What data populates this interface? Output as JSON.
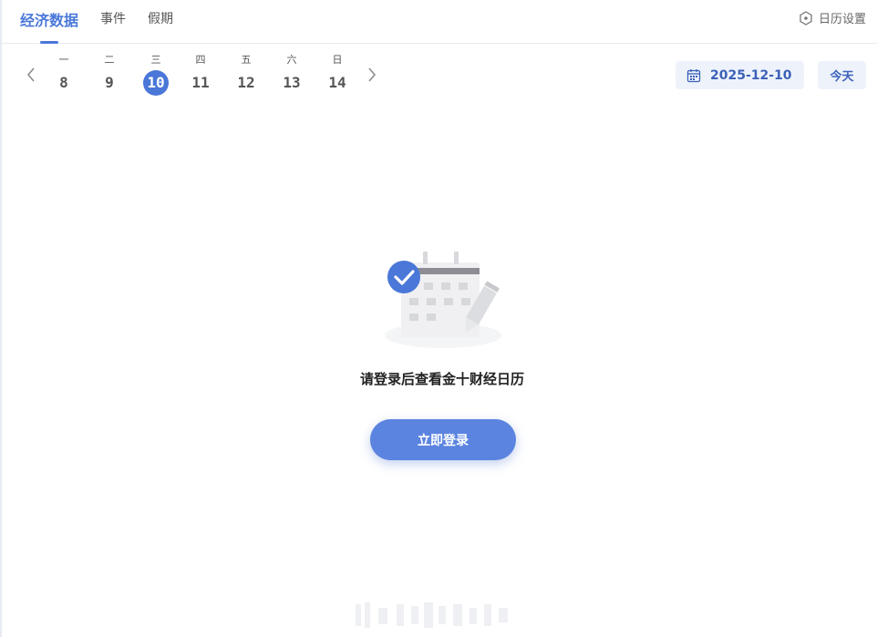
{
  "header": {
    "tabs": [
      {
        "label": "经济数据",
        "active": true
      },
      {
        "label": "事件",
        "active": false
      },
      {
        "label": "假期",
        "active": false
      }
    ],
    "settings_label": "日历设置",
    "settings_icon": "hexagon-settings-icon"
  },
  "week": {
    "prev_icon": "chevron-left-icon",
    "next_icon": "chevron-right-icon",
    "days": [
      {
        "weekday": "一",
        "num": "8"
      },
      {
        "weekday": "二",
        "num": "9"
      },
      {
        "weekday": "三",
        "num": "10",
        "selected": true
      },
      {
        "weekday": "四",
        "num": "11"
      },
      {
        "weekday": "五",
        "num": "12"
      },
      {
        "weekday": "六",
        "num": "13"
      },
      {
        "weekday": "日",
        "num": "14"
      }
    ]
  },
  "date_picker": {
    "value": "2025-12-10",
    "icon": "calendar-icon"
  },
  "today_button": "今天",
  "empty_state": {
    "message": "请登录后查看金十财经日历",
    "login_button": "立即登录",
    "illustration": "calendar-check-illustration"
  },
  "colors": {
    "accent": "#4a77d8",
    "button": "#5b84e0",
    "chip_bg": "#eef3fb"
  }
}
